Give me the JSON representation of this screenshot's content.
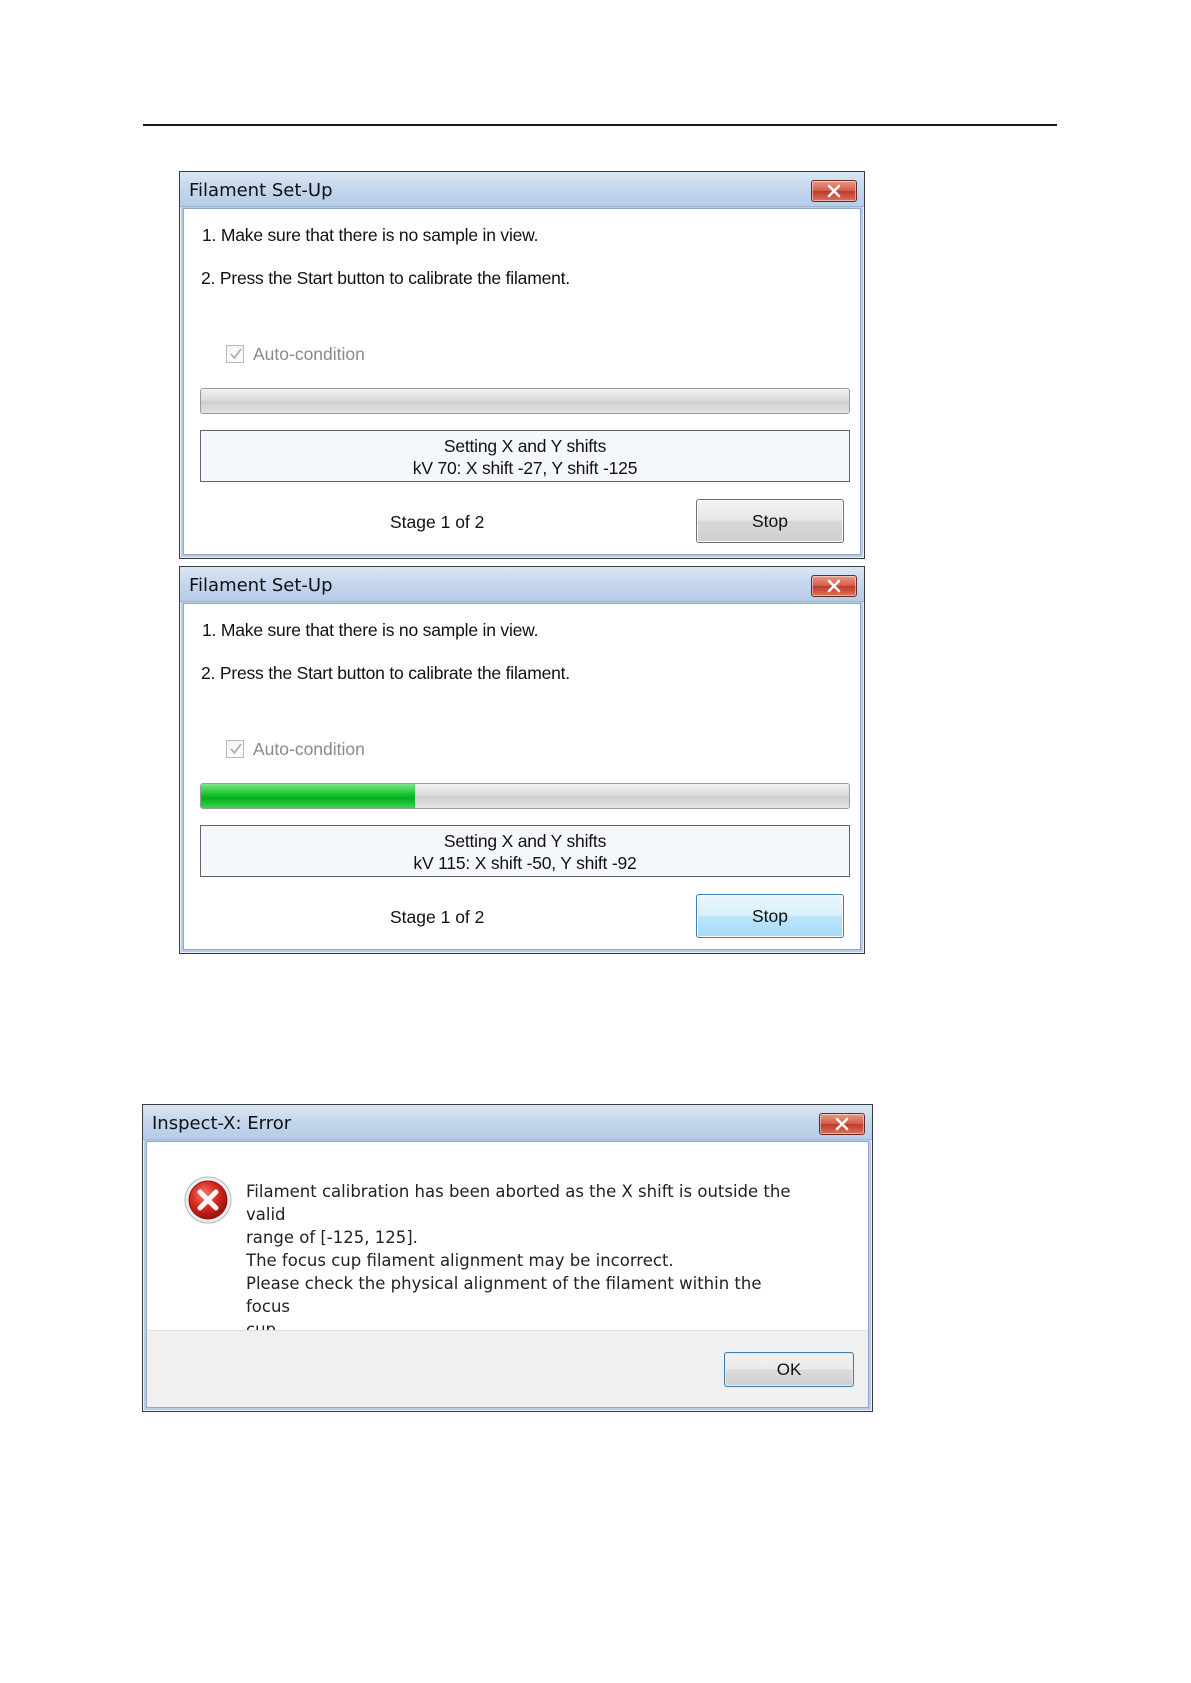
{
  "dialogs": [
    {
      "title": "Filament Set-Up",
      "instruction_1": "1. Make sure that there is no sample in view.",
      "instruction_2": "2. Press the Start button to calibrate the filament.",
      "checkbox_label": "Auto-condition",
      "checkbox_checked": true,
      "progress_percent": 0,
      "status_line_1": "Setting X and Y shifts",
      "status_line_2": "kV 70: X shift -27, Y shift -125",
      "stage_text": "Stage 1 of 2",
      "stop_label": "Stop"
    },
    {
      "title": "Filament Set-Up",
      "instruction_1": "1. Make sure that there is no sample in view.",
      "instruction_2": "2. Press the Start button to calibrate the filament.",
      "checkbox_label": "Auto-condition",
      "checkbox_checked": true,
      "progress_percent": 33,
      "status_line_1": "Setting X and Y shifts",
      "status_line_2": "kV 115: X shift -50, Y shift -92",
      "stage_text": "Stage 1 of 2",
      "stop_label": "Stop"
    }
  ],
  "error_dialog": {
    "title": "Inspect-X: Error",
    "icon": "error-icon",
    "message_lines": [
      "Filament calibration has been aborted as the X shift is outside the valid",
      "range of [-125, 125].",
      "The focus cup filament alignment may be incorrect.",
      "Please check the physical alignment of the filament within the focus",
      "cup."
    ],
    "ok_label": "OK"
  },
  "colors": {
    "title_bar": "#c3d5ec",
    "close_button": "#c0392b",
    "progress_fill": "#06b020",
    "status_box_bg": "#f4f8fd"
  }
}
